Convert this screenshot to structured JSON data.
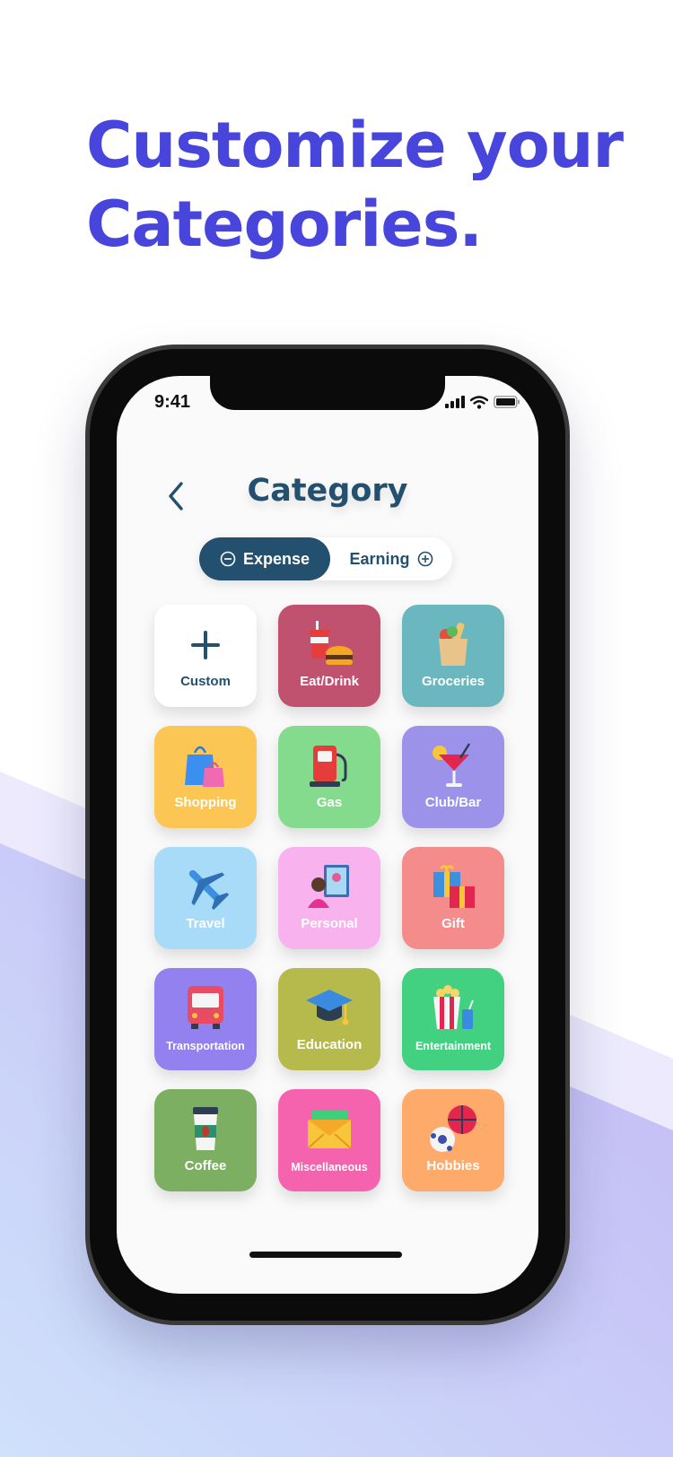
{
  "headline": {
    "line1": "Customize your",
    "line2": "Categories."
  },
  "status_bar": {
    "time": "9:41"
  },
  "nav": {
    "title": "Category"
  },
  "segment": {
    "expense_label": "Expense",
    "earning_label": "Earning"
  },
  "colors": {
    "accent": "#4845dd",
    "navy": "#23506e",
    "tiles": [
      "#ffffff",
      "#c0516f",
      "#6bb7c0",
      "#fcc655",
      "#84db8e",
      "#9c92ea",
      "#a8dbf8",
      "#f8b2ee",
      "#f48c8c",
      "#9281ef",
      "#b6b94c",
      "#42d081",
      "#7daf63",
      "#f562ae",
      "#fdaa6b"
    ]
  },
  "categories": [
    {
      "label": "Custom",
      "icon": "plus-icon"
    },
    {
      "label": "Eat/Drink",
      "icon": "fast-food-icon"
    },
    {
      "label": "Groceries",
      "icon": "grocery-bag-icon"
    },
    {
      "label": "Shopping",
      "icon": "shopping-bags-icon"
    },
    {
      "label": "Gas",
      "icon": "gas-pump-icon"
    },
    {
      "label": "Club/Bar",
      "icon": "cocktail-icon"
    },
    {
      "label": "Travel",
      "icon": "airplane-icon"
    },
    {
      "label": "Personal",
      "icon": "mirror-person-icon"
    },
    {
      "label": "Gift",
      "icon": "gift-box-icon"
    },
    {
      "label": "Transportation",
      "icon": "bus-icon"
    },
    {
      "label": "Education",
      "icon": "graduation-cap-icon"
    },
    {
      "label": "Entertainment",
      "icon": "popcorn-icon"
    },
    {
      "label": "Coffee",
      "icon": "coffee-cup-icon"
    },
    {
      "label": "Miscellaneous",
      "icon": "money-envelope-icon"
    },
    {
      "label": "Hobbies",
      "icon": "balls-icon"
    }
  ]
}
